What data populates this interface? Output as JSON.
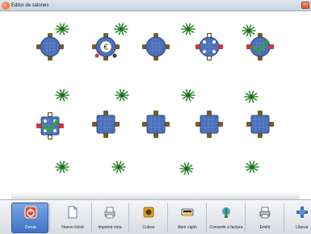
{
  "window": {
    "title": "Editor de salones"
  },
  "toolbar": {
    "buttons": [
      {
        "label": "Cerrar",
        "icon": "power-icon",
        "active": true
      },
      {
        "label": "Nuevo ticket",
        "icon": "new-ticket-icon"
      },
      {
        "label": "Imprimir nota",
        "icon": "print-note-icon"
      },
      {
        "label": "Cobrar",
        "icon": "charge-icon"
      },
      {
        "label": "Abrir cajón",
        "icon": "open-drawer-icon"
      },
      {
        "label": "Convertir a factura",
        "icon": "invoice-icon"
      },
      {
        "label": "Emitir",
        "icon": "printer-icon"
      },
      {
        "label": "Liberar",
        "icon": "release-icon"
      }
    ]
  },
  "floor": {
    "plants": 16,
    "tables": [
      {
        "shape": "round",
        "status": "free"
      },
      {
        "shape": "round",
        "status": "euro-charged"
      },
      {
        "shape": "round",
        "status": "free"
      },
      {
        "shape": "round",
        "status": "occupied"
      },
      {
        "shape": "round",
        "status": "checked"
      },
      {
        "shape": "square",
        "status": "occupied-checked"
      },
      {
        "shape": "square",
        "status": "free"
      },
      {
        "shape": "square",
        "status": "free"
      },
      {
        "shape": "square",
        "status": "free"
      },
      {
        "shape": "square",
        "status": "free"
      }
    ]
  },
  "colors": {
    "table_blue": "#4a6fb8",
    "chair_brown": "#7a5a2a",
    "plant_green": "#2d8a2d",
    "active_button": "#3f73c6"
  }
}
